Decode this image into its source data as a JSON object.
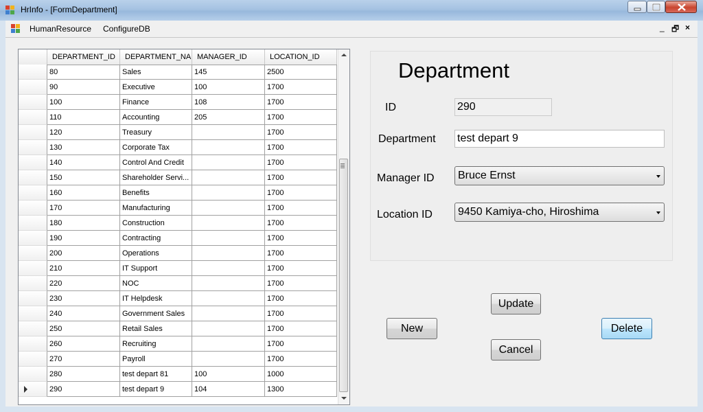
{
  "window": {
    "title": "HrInfo - [FormDepartment]",
    "colors": {
      "titlebar": "#a5c2e2",
      "close_button": "#c9452f",
      "client_bg": "#f0f0f0"
    }
  },
  "menu": {
    "items": [
      {
        "label": "HumanResource"
      },
      {
        "label": "ConfigureDB"
      }
    ],
    "mdi_controls": {
      "minimize": "_",
      "restore": "🗗",
      "close": "×"
    }
  },
  "grid": {
    "columns": [
      "DEPARTMENT_ID",
      "DEPARTMENT_NA",
      "MANAGER_ID",
      "LOCATION_ID"
    ],
    "rows": [
      [
        "80",
        "Sales",
        "145",
        "2500"
      ],
      [
        "90",
        "Executive",
        "100",
        "1700"
      ],
      [
        "100",
        "Finance",
        "108",
        "1700"
      ],
      [
        "110",
        "Accounting",
        "205",
        "1700"
      ],
      [
        "120",
        "Treasury",
        "",
        "1700"
      ],
      [
        "130",
        "Corporate Tax",
        "",
        "1700"
      ],
      [
        "140",
        "Control And Credit",
        "",
        "1700"
      ],
      [
        "150",
        "Shareholder Servi...",
        "",
        "1700"
      ],
      [
        "160",
        "Benefits",
        "",
        "1700"
      ],
      [
        "170",
        "Manufacturing",
        "",
        "1700"
      ],
      [
        "180",
        "Construction",
        "",
        "1700"
      ],
      [
        "190",
        "Contracting",
        "",
        "1700"
      ],
      [
        "200",
        "Operations",
        "",
        "1700"
      ],
      [
        "210",
        "IT Support",
        "",
        "1700"
      ],
      [
        "220",
        "NOC",
        "",
        "1700"
      ],
      [
        "230",
        "IT Helpdesk",
        "",
        "1700"
      ],
      [
        "240",
        "Government Sales",
        "",
        "1700"
      ],
      [
        "250",
        "Retail Sales",
        "",
        "1700"
      ],
      [
        "260",
        "Recruiting",
        "",
        "1700"
      ],
      [
        "270",
        "Payroll",
        "",
        "1700"
      ],
      [
        "280",
        "test depart 81",
        "100",
        "1000"
      ],
      [
        "290",
        "test depart 9",
        "104",
        "1300"
      ]
    ],
    "current_row": 21
  },
  "form": {
    "heading": "Department",
    "id_label": "ID",
    "id_value": "290",
    "department_label": "Department",
    "department_value": "test depart 9",
    "manager_label": "Manager ID",
    "manager_value": "Bruce Ernst",
    "location_label": "Location ID",
    "location_value": "9450 Kamiya-cho, Hiroshima"
  },
  "buttons": {
    "update": "Update",
    "new": "New",
    "delete": "Delete",
    "cancel": "Cancel"
  }
}
